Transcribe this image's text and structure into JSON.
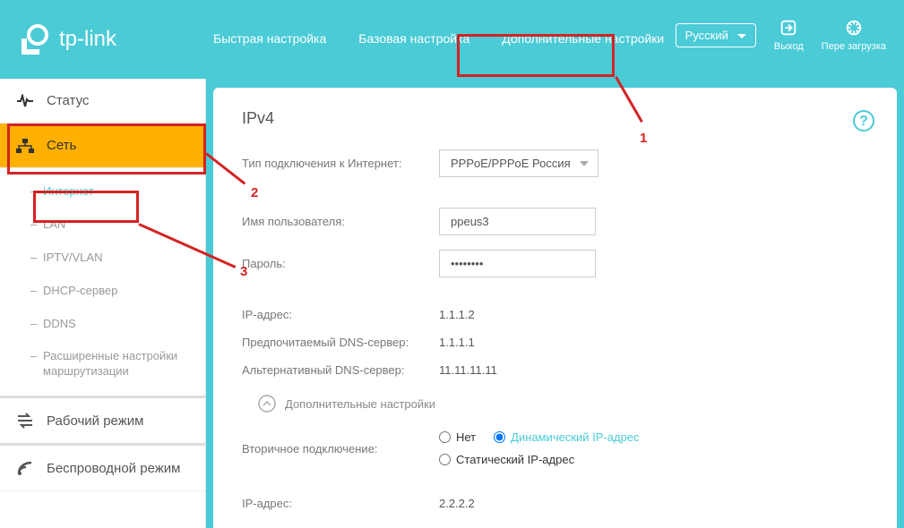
{
  "brand": "tp-link",
  "header": {
    "nav": {
      "quick": "Быстрая настройка",
      "basic": "Базовая настройка",
      "advanced": "Дополнительные настройки"
    },
    "language": "Русский",
    "logout": "Выход",
    "reboot": "Пере загрузка"
  },
  "sidebar": {
    "status": "Статус",
    "network": "Сеть",
    "submenu": {
      "internet": "Интернет",
      "lan": "LAN",
      "iptv": "IPTV/VLAN",
      "dhcp": "DHCP-сервер",
      "ddns": "DDNS",
      "routing": "Расширенные настройки маршрутизации"
    },
    "mode": "Рабочий режим",
    "wireless": "Беспроводной режим"
  },
  "main": {
    "title": "IPv4",
    "connection_type_label": "Тип подключения к Интернет:",
    "connection_type_value": "PPPoE/PPPoE Россия",
    "username_label": "Имя пользователя:",
    "username_value": "ppeus3",
    "password_label": "Пароль:",
    "password_value": "••••••••",
    "ip_label": "IP-адрес:",
    "ip_value": "1.1.1.2",
    "dns1_label": "Предпочитаемый DNS-сервер:",
    "dns1_value": "1.1.1.1",
    "dns2_label": "Альтернативный DNS-сервер:",
    "dns2_value": "11.11.11.11",
    "advanced_toggle": "Дополнительные настройки",
    "secondary_label": "Вторичное подключение:",
    "secondary_none": "Нет",
    "secondary_dynamic": "Динамический IP-адрес",
    "secondary_static": "Статический IP-адрес",
    "ip2_label": "IP-адрес:",
    "ip2_value": "2.2.2.2"
  },
  "annotations": {
    "n1": "1",
    "n2": "2",
    "n3": "3"
  }
}
